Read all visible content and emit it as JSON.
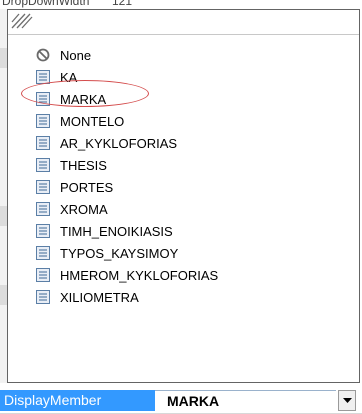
{
  "header_strip": {
    "property_name": "DropDownWidth",
    "property_value": "121"
  },
  "list": {
    "items": [
      {
        "label": "None",
        "icon": "none-icon"
      },
      {
        "label": "KA",
        "icon": "field-icon"
      },
      {
        "label": "MARKA",
        "icon": "field-icon"
      },
      {
        "label": "MONTELO",
        "icon": "field-icon"
      },
      {
        "label": "AR_KYKLOFORIAS",
        "icon": "field-icon"
      },
      {
        "label": "THESIS",
        "icon": "field-icon"
      },
      {
        "label": "PORTES",
        "icon": "field-icon"
      },
      {
        "label": "XROMA",
        "icon": "field-icon"
      },
      {
        "label": "TIMH_ENOIKIASIS",
        "icon": "field-icon"
      },
      {
        "label": "TYPOS_KAYSIMOY",
        "icon": "field-icon"
      },
      {
        "label": "HMEROM_KYKLOFORIAS",
        "icon": "field-icon"
      },
      {
        "label": "XILIOMETRA",
        "icon": "field-icon"
      }
    ],
    "highlighted_item": "MARKA"
  },
  "property_row": {
    "name": "DisplayMember",
    "value": "MARKA"
  },
  "colors": {
    "selection_blue": "#3399ff",
    "annotation_red": "#d44d4d",
    "icon_blue": "#5b7fa6"
  }
}
